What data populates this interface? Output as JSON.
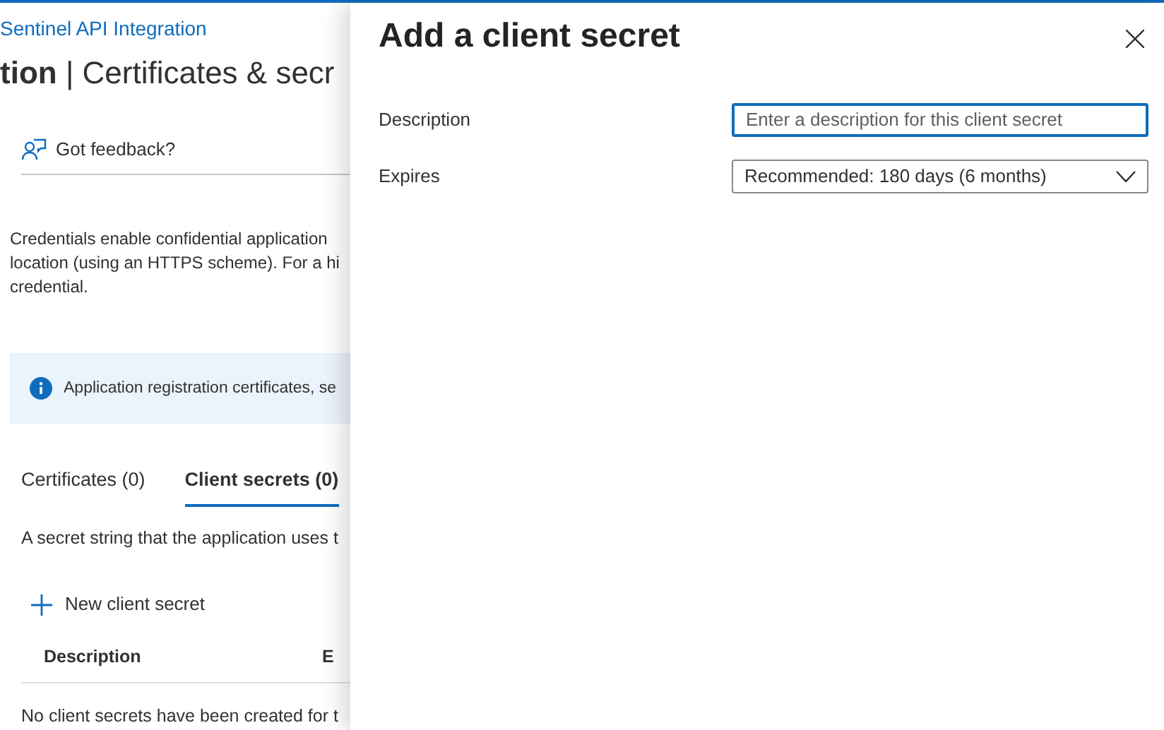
{
  "breadcrumb": "Sentinel API Integration",
  "page_title": "**tion** | Certificates & secr",
  "feedback": "Got feedback?",
  "intro_lines": [
    "Credentials enable confidential application",
    "location (using an HTTPS scheme). For a hi",
    "credential."
  ],
  "info_banner": "Application registration certificates, se",
  "tabs": [
    {
      "label": "Certificates (0)",
      "selected": false
    },
    {
      "label": "Client secrets (0)",
      "selected": true
    }
  ],
  "tab_description": "A secret string that the application uses t",
  "new_button": "New client secret",
  "table": {
    "columns": [
      "Description",
      "E"
    ],
    "empty_message": "No client secrets have been created for t"
  },
  "panel": {
    "title": "Add a client secret",
    "fields": [
      {
        "kind": "text",
        "label": "Description",
        "placeholder": "Enter a description for this client secret",
        "focused": true
      },
      {
        "kind": "select",
        "label": "Expires",
        "value": "Recommended: 180 days (6 months)"
      }
    ]
  }
}
